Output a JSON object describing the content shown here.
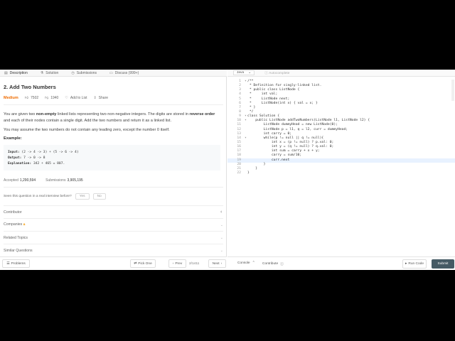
{
  "tabs": [
    {
      "label": "Description",
      "icon": "document-icon"
    },
    {
      "label": "Solution",
      "icon": "flask-icon"
    },
    {
      "label": "Submissions",
      "icon": "clock-icon"
    },
    {
      "label": "Discuss (999+)",
      "icon": "chat-icon"
    }
  ],
  "problem": {
    "title": "2. Add Two Numbers",
    "difficulty": "Medium",
    "likes": "7502",
    "dislikes": "1940",
    "add_to_list": "Add to List",
    "share": "Share",
    "desc_1": "You are given two ",
    "desc_b1": "non-empty",
    "desc_2": " linked lists representing two non-negative integers. The digits are stored in ",
    "desc_b2": "reverse order",
    "desc_3": " and each of their nodes contain a single digit. Add the two numbers and return it as a linked list.",
    "note": "You may assume the two numbers do not contain any leading zero, except the number 0 itself.",
    "example_label": "Example:",
    "example": {
      "input_label": "Input:",
      "input": " (2 -> 4 -> 3) + (5 -> 6 -> 4)",
      "output_label": "Output:",
      "output": " 7 -> 0 -> 8",
      "explanation_label": "Explanation:",
      "explanation": " 342 + 465 = 807."
    },
    "accepted_label": "Accepted",
    "accepted": "1,290,594",
    "submissions_label": "Submissions",
    "submissions": "3,905,195",
    "interview_q": "Seen this question in a real interview before?",
    "yes": "Yes",
    "no": "No"
  },
  "sections": [
    {
      "label": "Contributor"
    },
    {
      "label": "Companies"
    },
    {
      "label": "Related Topics"
    },
    {
      "label": "Similar Questions"
    }
  ],
  "bottom_left": {
    "problems": "Problems",
    "pick_one": "Pick One",
    "prev": "Prev",
    "page": "2/1411",
    "next": "Next"
  },
  "editor": {
    "language": "Java",
    "autocomplete": "Autocomplete",
    "lines": [
      "/**",
      " * Definition for singly-linked list.",
      " * public class ListNode {",
      " *     int val;",
      " *     ListNode next;",
      " *     ListNode(int x) { val = x; }",
      " * }",
      " */",
      "class Solution {",
      "    public ListNode addTwoNumbers(ListNode l1, ListNode l2) {",
      "        ListNode dummyHead = new ListNode(0);",
      "        ListNode p = l1, q = l2, curr = dummyHead;",
      "        int carry = 0;",
      "        while(p != null || q != null){",
      "            int x = (p != null) ? p.val: 0;",
      "            int y = (q != null) ? q.val: 0;",
      "            int sum = carry + x + y;",
      "            carry = sum/10;",
      "            curr.next",
      "        }",
      "    }",
      "}"
    ],
    "active_line": 19
  },
  "bottom_right": {
    "console": "Console",
    "contribute": "Contribute",
    "run": "Run Code",
    "submit": "Submit"
  }
}
